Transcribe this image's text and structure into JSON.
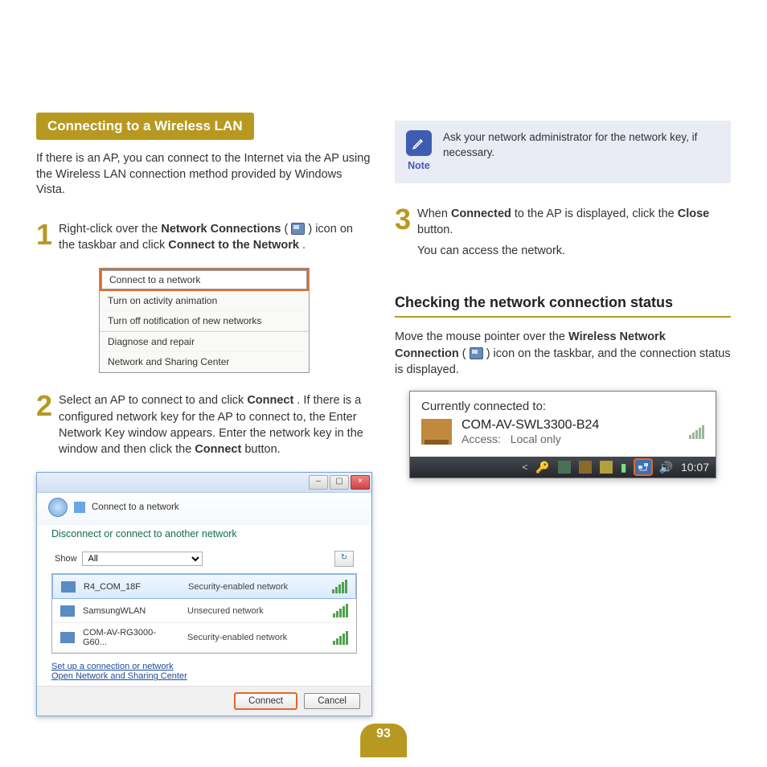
{
  "section_title": "Connecting to a Wireless LAN",
  "intro_text": "If there is an AP, you can connect to the Internet via the AP using the Wireless LAN connection method provided by Windows Vista.",
  "step1": {
    "num": "1",
    "pre": "Right-click over the ",
    "bold1": "Network Connections",
    "mid": " (",
    "post_icon": ") icon on the taskbar and click ",
    "bold2": "Connect to the Network",
    "end": "."
  },
  "menu": {
    "items": [
      "Connect to a network",
      "Turn on activity animation",
      "Turn off notification of new networks",
      "Diagnose and repair",
      "Network and Sharing Center"
    ]
  },
  "step2": {
    "num": "2",
    "t1": "Select an AP to connect to and click ",
    "b1": "Connect",
    "t2": ". If there is a configured network key for the AP to connect to, the Enter Network Key window appears. Enter the network key in the window and then click the ",
    "b2": "Connect",
    "t3": " button."
  },
  "dialog": {
    "title": "Connect to a network",
    "header": "Disconnect or connect to another network",
    "show_label": "Show",
    "show_value": "All",
    "networks": [
      {
        "name": "R4_COM_18F",
        "security": "Security-enabled network"
      },
      {
        "name": "SamsungWLAN",
        "security": "Unsecured network"
      },
      {
        "name": "COM-AV-RG3000-G60...",
        "security": "Security-enabled network"
      }
    ],
    "link1": "Set up a connection or network",
    "link2": "Open Network and Sharing Center",
    "btn_connect": "Connect",
    "btn_cancel": "Cancel"
  },
  "note": {
    "label": "Note",
    "text": "Ask your network administrator for the network key, if necessary."
  },
  "step3": {
    "num": "3",
    "t1": "When ",
    "b1": "Connected",
    "t2": " to the AP is displayed, click the ",
    "b2": "Close",
    "t3": " button.",
    "line2": "You can access the network."
  },
  "subhead": "Checking the network connection status",
  "check_para": {
    "t1": "Move the mouse pointer over the ",
    "b1": "Wireless Network Connection",
    "t2": " (",
    "t3": ") icon on the taskbar, and the connection status is displayed."
  },
  "tooltip": {
    "header": "Currently connected to:",
    "name": "COM-AV-SWL3300-B24",
    "access_label": "Access:",
    "access_value": "Local only",
    "time": "10:07"
  },
  "page_number": "93"
}
